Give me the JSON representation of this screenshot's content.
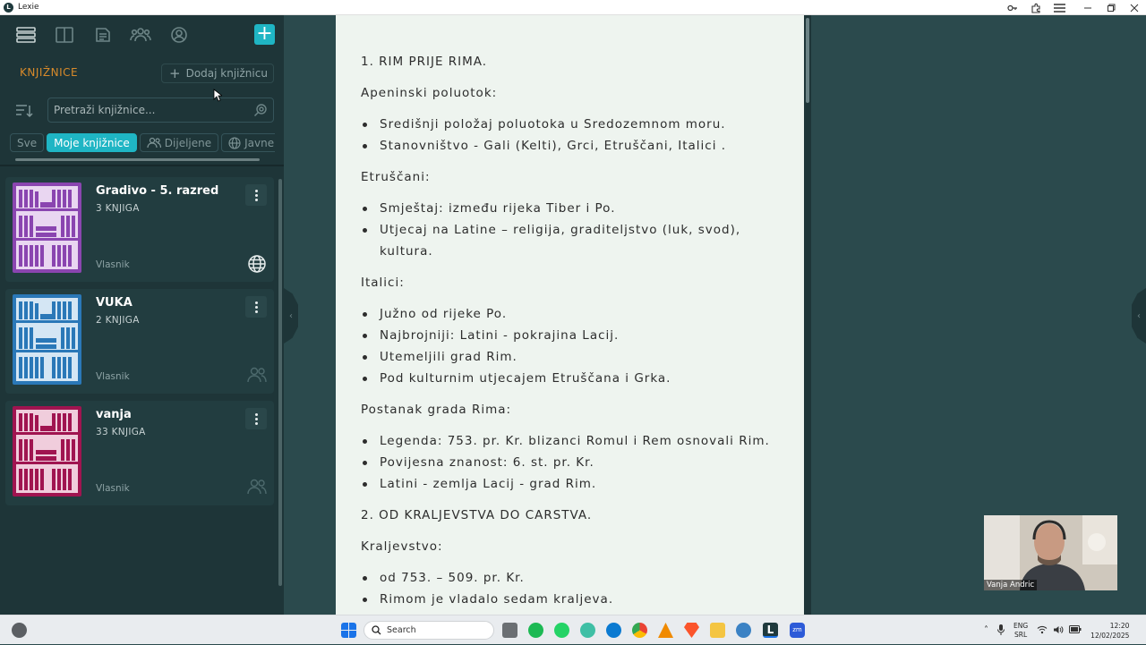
{
  "window": {
    "title": "Lexie"
  },
  "sidebar": {
    "heading": "KNJIŽNICE",
    "add_library_label": "Dodaj knjižnicu",
    "search_placeholder": "Pretraži knjižnice...",
    "filters": [
      {
        "label": "Sve",
        "active": false
      },
      {
        "label": "Moje knjižnice",
        "active": true
      },
      {
        "label": "Dijeljene",
        "active": false
      },
      {
        "label": "Javne",
        "active": false
      }
    ],
    "libraries": [
      {
        "name": "Gradivo - 5. razred",
        "count": "3 KNJIGA",
        "owner": "Vlasnik",
        "color": "#8a45b0",
        "share_icon": "globe-icon"
      },
      {
        "name": "VUKA",
        "count": "2 KNJIGA",
        "owner": "Vlasnik",
        "color": "#2a78b8",
        "share_icon": "users-icon"
      },
      {
        "name": "vanja",
        "count": "33 KNJIGA",
        "owner": "Vlasnik",
        "color": "#a01450",
        "share_icon": "users-icon"
      }
    ]
  },
  "document": {
    "blocks": [
      {
        "type": "p",
        "text": "1. RIM PRIJE RIMA."
      },
      {
        "type": "p",
        "text": "Apeninski poluotok:"
      },
      {
        "type": "ul",
        "items": [
          "Središnji položaj poluotoka u Sredozemnom moru.",
          "Stanovništvo - Gali (Kelti), Grci, Etruščani, Italici ."
        ]
      },
      {
        "type": "p",
        "text": "Etruščani:"
      },
      {
        "type": "ul",
        "items": [
          "Smještaj: između rijeka Tiber i Po.",
          "Utjecaj na Latine – religija, graditeljstvo (luk, svod), kultura."
        ]
      },
      {
        "type": "p",
        "text": "Italici:"
      },
      {
        "type": "ul",
        "items": [
          "Južno od rijeke Po.",
          "Najbrojniji: Latini - pokrajina Lacij.",
          "Utemeljili grad Rim.",
          "Pod kulturnim utjecajem Etruščana i Grka."
        ]
      },
      {
        "type": "p",
        "text": "Postanak grada Rima:"
      },
      {
        "type": "ul",
        "items": [
          "Legenda: 753. pr. Kr. blizanci Romul i Rem osnovali Rim.",
          "Povijesna znanost: 6. st. pr. Kr.",
          "Latini - zemlja Lacij - grad Rim."
        ]
      },
      {
        "type": "p",
        "text": "2. OD KRALJEVSTVA DO CARSTVA."
      },
      {
        "type": "p",
        "text": "Kraljevstvo:"
      },
      {
        "type": "ul",
        "items": [
          "od 753. – 509. pr. Kr.",
          "Rimom je vladalo sedam kraljeva."
        ]
      }
    ]
  },
  "webcam": {
    "participant_name": "Vanja Andric"
  },
  "taskbar": {
    "search_label": "Search",
    "language": "ENG",
    "keyboard": "SRL",
    "time": "12:20",
    "date": "12/02/2025"
  }
}
